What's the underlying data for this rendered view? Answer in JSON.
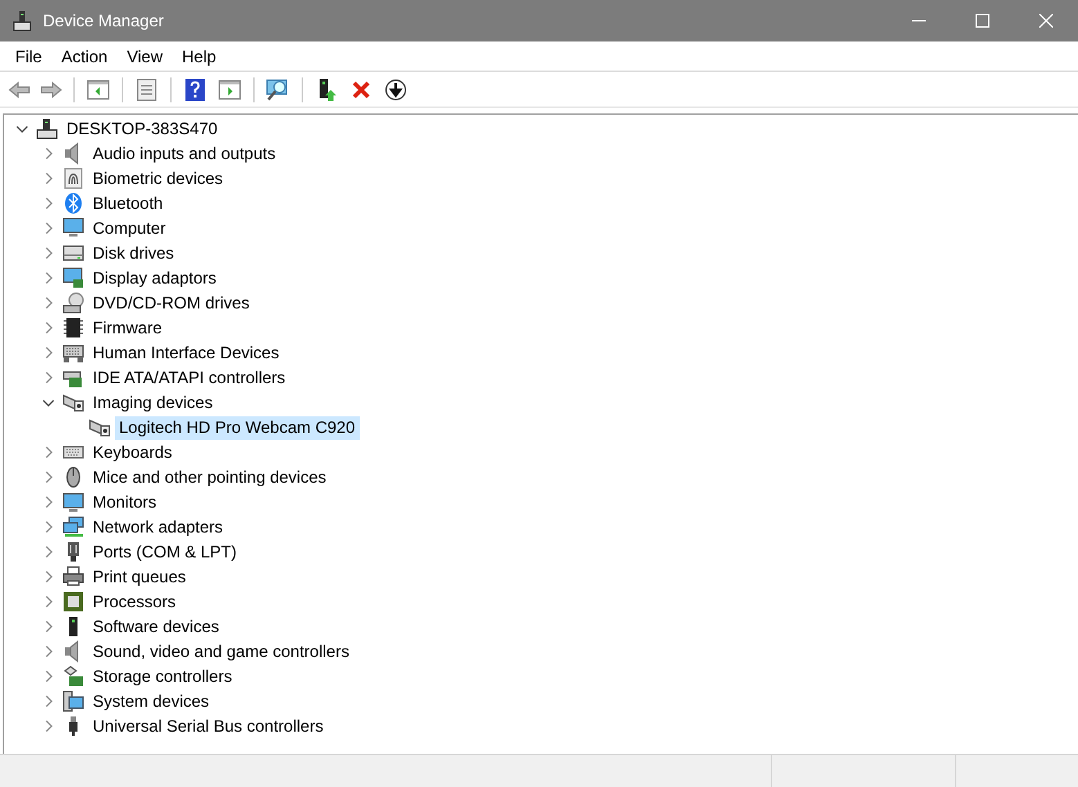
{
  "window": {
    "title": "Device Manager"
  },
  "menu": [
    "File",
    "Action",
    "View",
    "Help"
  ],
  "tree": [
    {
      "label": "DESKTOP-383S470",
      "expanded": true,
      "selected": false,
      "children": [
        {
          "label": "Audio inputs and outputs",
          "expanded": false,
          "selected": false
        },
        {
          "label": "Biometric devices",
          "expanded": false,
          "selected": false
        },
        {
          "label": "Bluetooth",
          "expanded": false,
          "selected": false
        },
        {
          "label": "Computer",
          "expanded": false,
          "selected": false
        },
        {
          "label": "Disk drives",
          "expanded": false,
          "selected": false
        },
        {
          "label": "Display adaptors",
          "expanded": false,
          "selected": false
        },
        {
          "label": "DVD/CD-ROM drives",
          "expanded": false,
          "selected": false
        },
        {
          "label": "Firmware",
          "expanded": false,
          "selected": false
        },
        {
          "label": "Human Interface Devices",
          "expanded": false,
          "selected": false
        },
        {
          "label": "IDE ATA/ATAPI controllers",
          "expanded": false,
          "selected": false
        },
        {
          "label": "Imaging devices",
          "expanded": true,
          "selected": false,
          "children": [
            {
              "label": "Logitech HD Pro Webcam C920",
              "selected": true
            }
          ]
        },
        {
          "label": "Keyboards",
          "expanded": false,
          "selected": false
        },
        {
          "label": "Mice and other pointing devices",
          "expanded": false,
          "selected": false
        },
        {
          "label": "Monitors",
          "expanded": false,
          "selected": false
        },
        {
          "label": "Network adapters",
          "expanded": false,
          "selected": false
        },
        {
          "label": "Ports (COM & LPT)",
          "expanded": false,
          "selected": false
        },
        {
          "label": "Print queues",
          "expanded": false,
          "selected": false
        },
        {
          "label": "Processors",
          "expanded": false,
          "selected": false
        },
        {
          "label": "Software devices",
          "expanded": false,
          "selected": false
        },
        {
          "label": "Sound, video and game controllers",
          "expanded": false,
          "selected": false
        },
        {
          "label": "Storage controllers",
          "expanded": false,
          "selected": false
        },
        {
          "label": "System devices",
          "expanded": false,
          "selected": false
        },
        {
          "label": "Universal Serial Bus controllers",
          "expanded": false,
          "selected": false
        }
      ]
    }
  ]
}
